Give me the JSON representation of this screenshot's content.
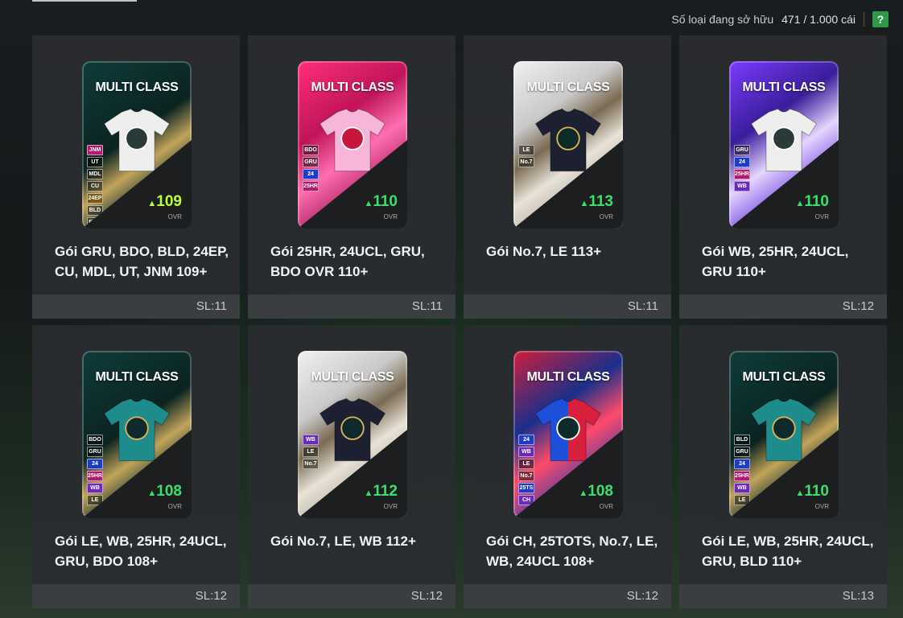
{
  "header": {
    "label": "Số loại đang sở hữu",
    "count": "471 / 1.000 cái",
    "help_label": "?"
  },
  "card_badge": "MULTI CLASS",
  "ovr_label": "OVR",
  "packs": [
    {
      "name": "Gói GRU, BDO, BLD, 24EP, CU, MDL, UT, JNM 109+",
      "qty": "SL:11",
      "ovr": "109",
      "theme": "bg-teal",
      "labels": [
        "JNM",
        "UT",
        "MDL",
        "CU",
        "24EP",
        "BLD",
        "BDO",
        "GRU"
      ],
      "shirt": "white",
      "icon": "cube-icon",
      "ovr_color": "lime"
    },
    {
      "name": "Gói 25HR, 24UCL, GRU, BDO OVR 110+",
      "qty": "SL:11",
      "ovr": "110",
      "theme": "bg-pink",
      "labels": [
        "BDO",
        "GRU",
        "24",
        "25HR"
      ],
      "shirt": "pink",
      "icon": "ball-shield-icon",
      "ovr_color": "green"
    },
    {
      "name": "Gói No.7, LE 113+",
      "qty": "SL:11",
      "ovr": "113",
      "theme": "bg-white",
      "labels": [
        "LE",
        "No.7"
      ],
      "shirt": "dark",
      "icon": "seven-badge-icon",
      "ovr_color": "green"
    },
    {
      "name": "Gói WB, 25HR, 24UCL, GRU 110+",
      "qty": "SL:12",
      "ovr": "110",
      "theme": "bg-purple",
      "labels": [
        "GRU",
        "24",
        "25HR",
        "WB"
      ],
      "shirt": "white",
      "icon": "diamond-icon",
      "ovr_color": "green"
    },
    {
      "name": "Gói LE, WB, 25HR, 24UCL, GRU, BDO 108+",
      "qty": "SL:12",
      "ovr": "108",
      "theme": "bg-teal",
      "labels": [
        "BDO",
        "GRU",
        "24",
        "25HR",
        "WB",
        "LE"
      ],
      "shirt": "teal",
      "icon": "compass-shield-icon",
      "ovr_color": "green"
    },
    {
      "name": "Gói No.7, LE, WB 112+",
      "qty": "SL:12",
      "ovr": "112",
      "theme": "bg-white",
      "labels": [
        "WB",
        "LE",
        "No.7"
      ],
      "shirt": "dark",
      "icon": "seven-badge-icon",
      "ovr_color": "green"
    },
    {
      "name": "Gói CH, 25TOTS, No.7, LE, WB, 24UCL 108+",
      "qty": "SL:12",
      "ovr": "108",
      "theme": "bg-red",
      "labels": [
        "24",
        "WB",
        "LE",
        "No.7",
        "25TS",
        "CH"
      ],
      "shirt": "split",
      "icon": "v-logo-icon",
      "ovr_color": "green"
    },
    {
      "name": "Gói LE, WB, 25HR, 24UCL, GRU, BLD 110+",
      "qty": "SL:13",
      "ovr": "110",
      "theme": "bg-teal",
      "labels": [
        "BLD",
        "GRU",
        "24",
        "25HR",
        "WB",
        "LE"
      ],
      "shirt": "teal",
      "icon": "compass-shield-icon",
      "ovr_color": "green"
    }
  ]
}
